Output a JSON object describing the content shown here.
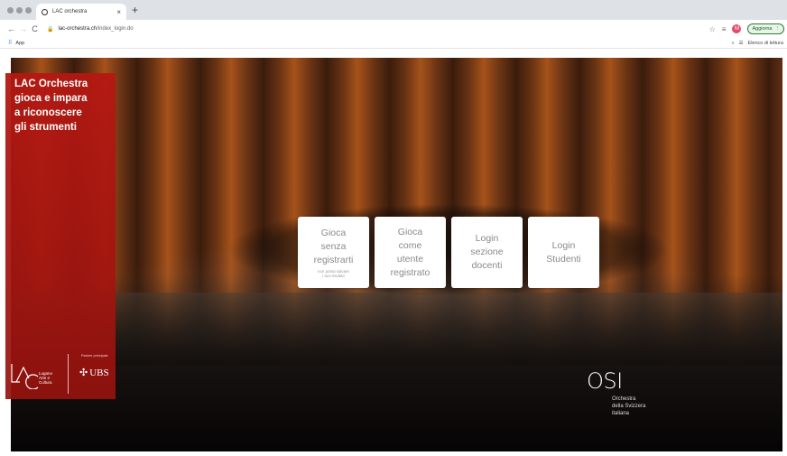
{
  "browser": {
    "tab_title": "LAC orchestra",
    "tab_close": "×",
    "new_tab": "+",
    "url_host": "lac-orchestra.ch",
    "url_path": "/index_login.do",
    "avatar_letter": "M",
    "update_label": "Aggiorna",
    "bookmarks_apps": "App",
    "reading_list": "Elenco di lettura"
  },
  "panel": {
    "title_lines": [
      "LAC Orchestra",
      "gioca e impara",
      "a riconoscere",
      "gli strumenti"
    ],
    "lac_text": [
      "Lugano",
      "Arte e",
      "Cultura"
    ],
    "partner_label": "Partner principale",
    "ubs_label": "UBS"
  },
  "cards": [
    {
      "label_lines": [
        "Gioca",
        "senza",
        "registrarti"
      ],
      "note_lines": [
        "non potrai salvare",
        "i tuoi risultati"
      ]
    },
    {
      "label_lines": [
        "Gioca",
        "come",
        "utente",
        "registrato"
      ]
    },
    {
      "label_lines": [
        "Login",
        "sezione",
        "docenti"
      ]
    },
    {
      "label_lines": [
        "Login",
        "Studenti"
      ]
    }
  ],
  "osi": {
    "mark": "OSI",
    "sub_lines": [
      "Orchestra",
      "della Svizzera",
      "italiana"
    ]
  },
  "colors": {
    "panel_red": "#b41812",
    "card_text": "#8a8a8a"
  }
}
